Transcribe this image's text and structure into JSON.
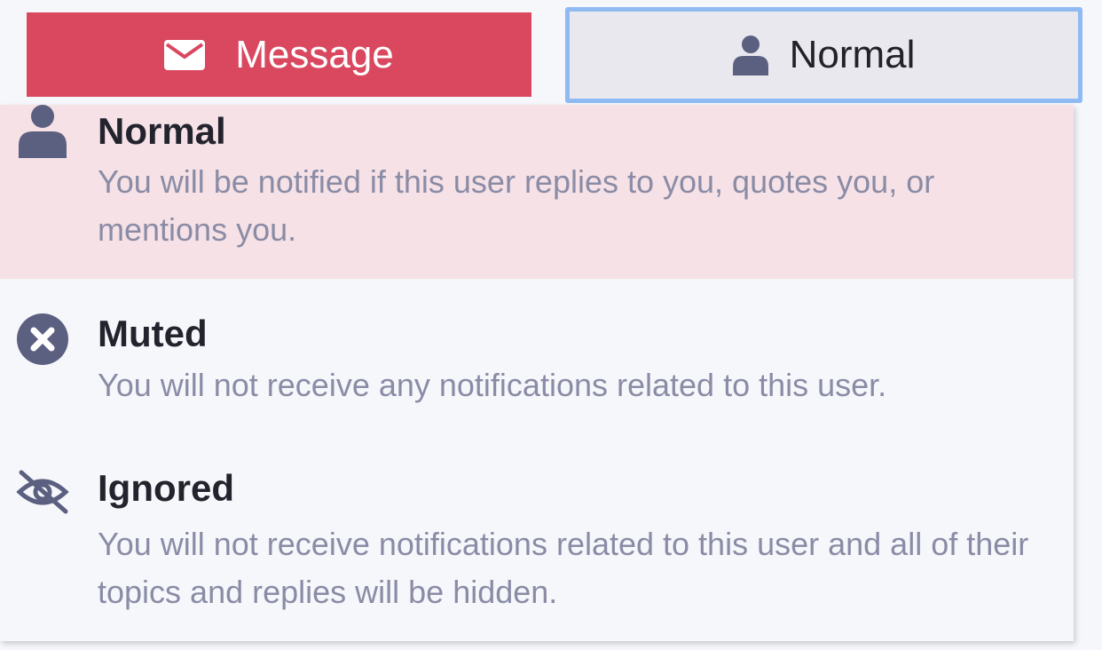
{
  "message_button": {
    "label": "Message",
    "icon": "envelope-icon",
    "color": "#d9485f"
  },
  "notification_button": {
    "label": "Normal",
    "icon": "user-icon"
  },
  "menu": {
    "options": [
      {
        "title": "Normal",
        "description": "You will be notified if this user replies to you, quotes you, or mentions you.",
        "icon": "user-icon",
        "selected": true
      },
      {
        "title": "Muted",
        "description": "You will not receive any notifications related to this user.",
        "icon": "times-circle-icon",
        "selected": false
      },
      {
        "title": "Ignored",
        "description": "You will not receive notifications related to this user and all of their topics and replies will be hidden.",
        "icon": "eye-slash-icon",
        "selected": false
      }
    ]
  },
  "colors": {
    "selected_bg": "#f6e1e6",
    "focus_border": "#8fbaf2",
    "icon": "#5c6080"
  }
}
